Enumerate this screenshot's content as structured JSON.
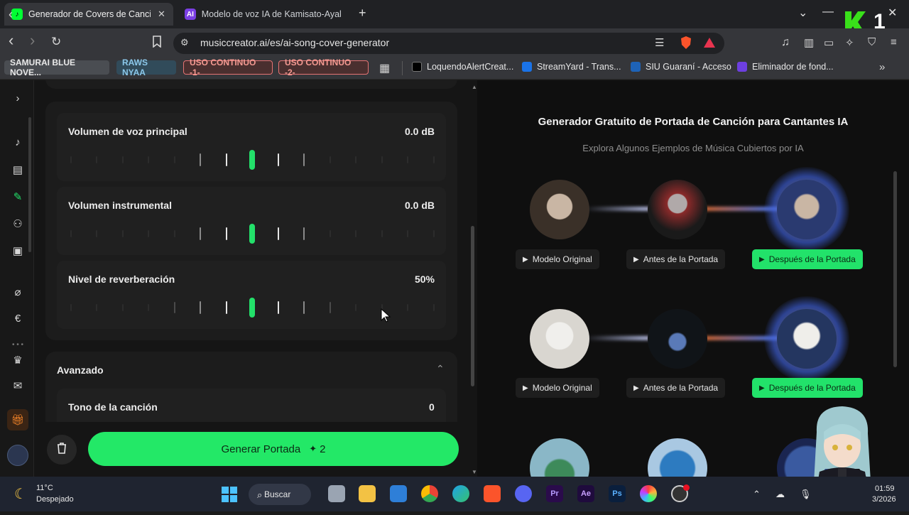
{
  "tabs": [
    {
      "title": "Generador de Covers de Cancion",
      "active": true
    },
    {
      "title": "Modelo de voz IA de Kamisato-Ayaka",
      "active": false
    }
  ],
  "window": {
    "minimize": "—",
    "maximize": "☐",
    "close": "✕",
    "overlay_digit": "1"
  },
  "toolbar": {
    "url": "musiccreator.ai/es/ai-song-cover-generator"
  },
  "bookmarks": {
    "chips": [
      {
        "label": "SAMURAI BLUE NOVE...",
        "color": "#9aa0a6"
      },
      {
        "label": "RAWS NYAA",
        "color": "#86c1e6"
      },
      {
        "label": "USO CONTINUO -1-",
        "color": "#f28b82"
      },
      {
        "label": "USO CONTINUO -2-",
        "color": "#f28b82"
      }
    ],
    "links": [
      "LoquendoAlertCreat...",
      "StreamYard - Trans...",
      "SIU Guaraní - Acceso",
      "Eliminador de fond..."
    ]
  },
  "sliders": [
    {
      "label": "Volumen de voz principal",
      "value": "0.0 dB"
    },
    {
      "label": "Volumen instrumental",
      "value": "0.0 dB"
    },
    {
      "label": "Nivel de reverberación",
      "value": "50%"
    }
  ],
  "advanced": {
    "title": "Avanzado",
    "tone_label": "Tono de la canción",
    "tone_value": "0"
  },
  "generate": {
    "label": "Generar Portada",
    "credits": "2"
  },
  "examples": {
    "title": "Generador Gratuito de Portada de Canción para Cantantes IA",
    "subtitle": "Explora Algunos Ejemplos de Música Cubiertos por IA",
    "buttons": {
      "original": "Modelo Original",
      "before": "Antes de la Portada",
      "after": "Después de la Portada"
    }
  },
  "taskbar": {
    "temperature": "11°C",
    "weather": "Despejado",
    "search": "Buscar",
    "time": "01:59",
    "date": "3/2026"
  }
}
